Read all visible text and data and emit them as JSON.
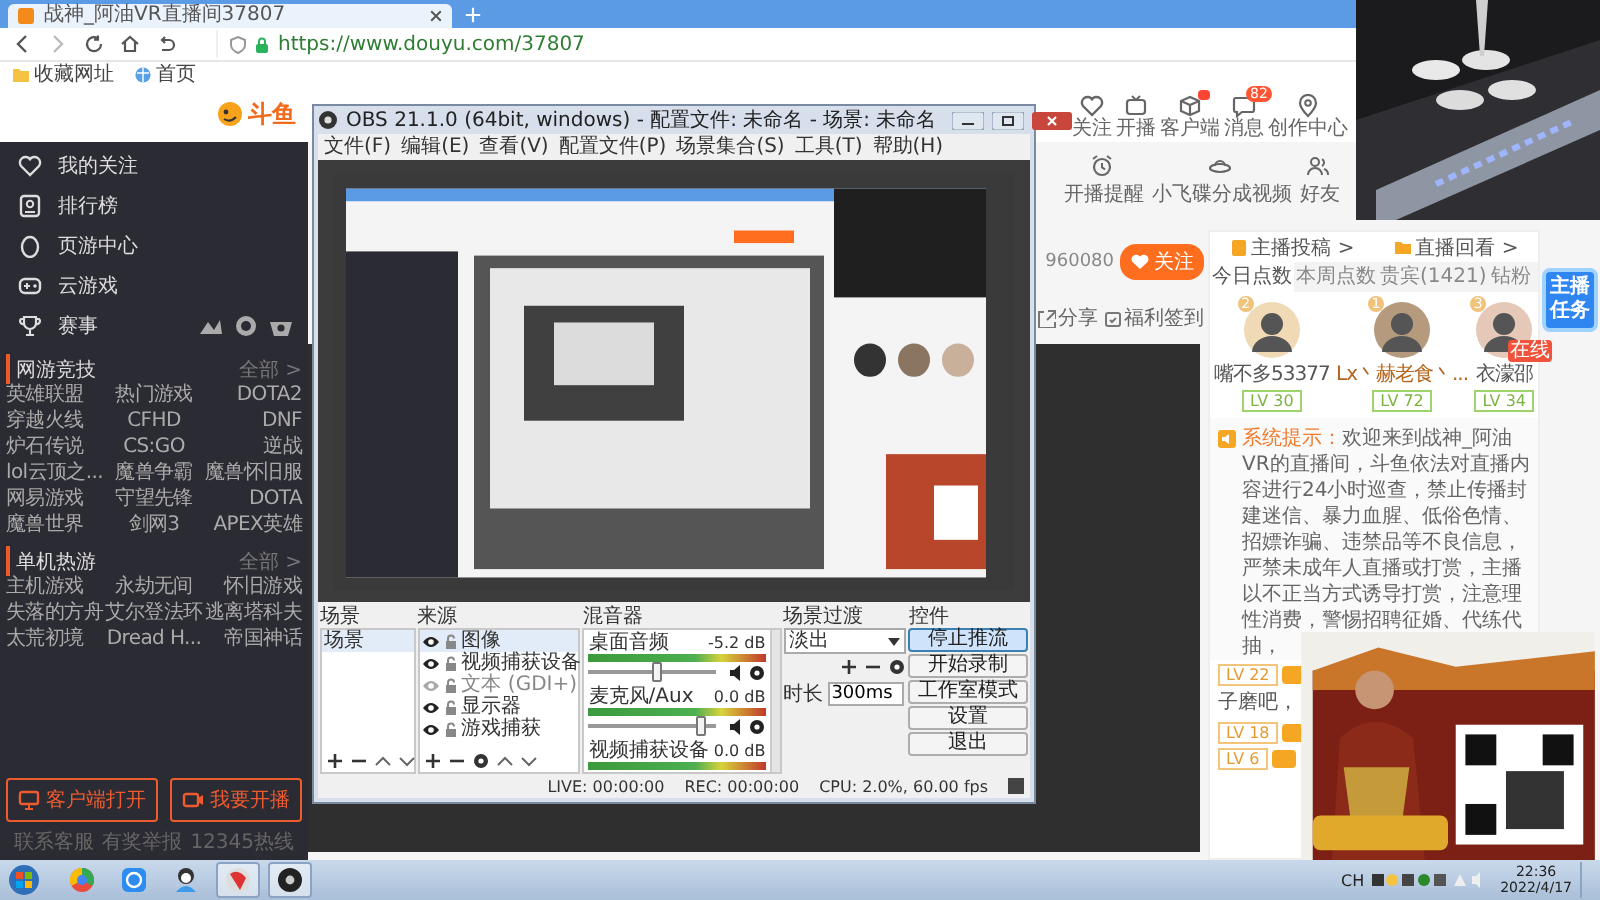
{
  "browser": {
    "tab_title": "战神_阿油VR直播间37807",
    "url": "https://www.douyu.com/37807",
    "bookmarks": [
      "收藏网址",
      "首页"
    ]
  },
  "header": {
    "logo": "斗鱼",
    "actions": [
      {
        "label": "关注",
        "dot": false
      },
      {
        "label": "开播",
        "dot": false
      },
      {
        "label": "客户端",
        "dot": true
      },
      {
        "label": "消息",
        "dot": false,
        "badge": "82"
      },
      {
        "label": "创作中心",
        "dot": false
      }
    ]
  },
  "sidebar": {
    "nav": [
      "我的关注",
      "排行榜",
      "页游中心",
      "云游戏",
      "赛事"
    ],
    "sections": [
      {
        "title": "网游竞技",
        "more": "全部 >",
        "games": [
          "英雄联盟",
          "热门游戏",
          "DOTA2",
          "穿越火线",
          "CFHD",
          "DNF",
          "炉石传说",
          "CS:GO",
          "逆战",
          "lol云顶之...",
          "魔兽争霸",
          "魔兽怀旧服",
          "网易游戏",
          "守望先锋",
          "DOTA",
          "魔兽世界",
          "剑网3",
          "APEX英雄"
        ]
      },
      {
        "title": "单机热游",
        "more": "全部 >",
        "games": [
          "主机游戏",
          "永劫无间",
          "怀旧游戏",
          "失落的方舟",
          "艾尔登法环",
          "逃离塔科夫",
          "太荒初境",
          "Dread H...",
          "帝国神话"
        ]
      }
    ],
    "buttons": [
      "客户端打开",
      "我要开播"
    ],
    "footer": [
      "联系客服",
      "有奖举报",
      "12345热线"
    ]
  },
  "room": {
    "tools": [
      "开播提醒",
      "小飞碟分成视频",
      "好友"
    ],
    "count": "960080",
    "follow": "关注",
    "share": "分享",
    "checkin": "福利签到"
  },
  "chat": {
    "links": [
      "主播投稿 >",
      "直播回看 >"
    ],
    "tabs": [
      {
        "label": "今日点数",
        "selected": true
      },
      {
        "label": "本周点数",
        "selected": false
      },
      {
        "label": "贵宾(1421)",
        "selected": false
      },
      {
        "label": "钻粉",
        "selected": false
      }
    ],
    "top": [
      {
        "rank": "2",
        "name": "嘴不多53377",
        "level": "LV 30"
      },
      {
        "rank": "1",
        "name": "Lx丶赫老食丶...",
        "level": "LV 72"
      },
      {
        "rank": "3",
        "name": "衣濛邵",
        "level": "LV 34",
        "tag": "在线"
      }
    ],
    "system": {
      "label": "系统提示：",
      "text": "欢迎来到战神_阿油VR的直播间，斗鱼依法对直播内容进行24小时巡查，禁止传播封建迷信、暴力血腥、低俗色情、招嫖诈骗、违禁品等不良信息，严禁未成年人直播或打赏，主播以不正当方式诱导打赏，注意理性消费，警惕招聘征婚、代练代抽，"
    },
    "messages": [
      {
        "level": "LV 22",
        "text": "子磨吧，"
      },
      {
        "level": "LV 18"
      },
      {
        "level": "LV 6"
      }
    ],
    "task_badge": "主播任务"
  },
  "obs": {
    "title": "OBS 21.1.0 (64bit, windows) - 配置文件: 未命名 - 场景: 未命名",
    "menu": [
      "文件(F)",
      "编辑(E)",
      "查看(V)",
      "配置文件(P)",
      "场景集合(S)",
      "工具(T)",
      "帮助(H)"
    ],
    "scenes": {
      "title": "场景",
      "items": [
        {
          "label": "场景",
          "selected": true
        }
      ]
    },
    "sources": {
      "title": "来源",
      "items": [
        {
          "label": "图像",
          "visible": true,
          "selected": true
        },
        {
          "label": "视频捕获设备",
          "visible": true,
          "selected": false
        },
        {
          "label": "文本 (GDI+)",
          "visible": false,
          "selected": false
        },
        {
          "label": "显示器",
          "visible": true,
          "selected": false
        },
        {
          "label": "游戏捕获",
          "visible": true,
          "selected": false
        }
      ]
    },
    "mixer": {
      "title": "混音器",
      "channels": [
        {
          "name": "桌面音频",
          "reading": "-5.2 dB",
          "level": 0.55
        },
        {
          "name": "麦克风/Aux",
          "reading": "0.0 dB",
          "level": 0.9
        },
        {
          "name": "视频捕获设备",
          "reading": "0.0 dB"
        }
      ]
    },
    "transitions": {
      "title": "场景过渡",
      "selected": "淡出",
      "duration_label": "时长",
      "duration": "300ms"
    },
    "controls": {
      "title": "控件",
      "buttons": [
        {
          "label": "停止推流",
          "active": true
        },
        {
          "label": "开始录制",
          "active": false
        },
        {
          "label": "工作室模式",
          "active": false
        },
        {
          "label": "设置",
          "active": false
        },
        {
          "label": "退出",
          "active": false
        }
      ]
    },
    "status": [
      "LIVE: 00:00:00",
      "REC: 00:00:00",
      "CPU: 2.0%, 60.00 fps"
    ]
  },
  "taskbar": {
    "apps": [
      {
        "selected": false
      },
      {
        "selected": false
      },
      {
        "selected": false
      },
      {
        "selected": true
      },
      {
        "selected": true
      }
    ],
    "ime": "CH",
    "time": "22:36",
    "date": "2022/4/17"
  }
}
